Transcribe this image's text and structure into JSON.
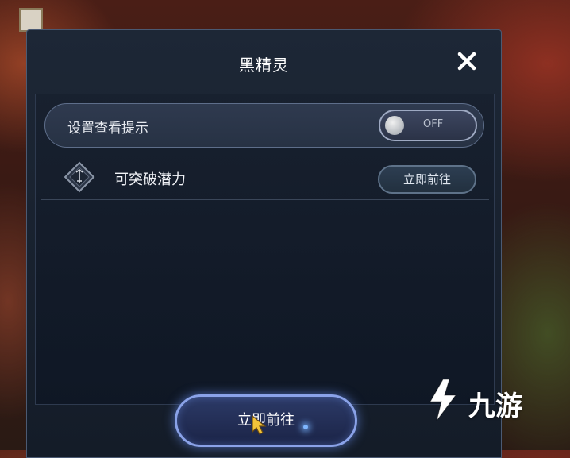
{
  "dialog": {
    "title": "黑精灵",
    "close_icon": "close-icon"
  },
  "settings": {
    "hint_label": "设置查看提示",
    "toggle_state": "OFF"
  },
  "items": [
    {
      "label": "可突破潜力",
      "button_label": "立即前往",
      "icon": "sword-diamond-icon"
    }
  ],
  "footer": {
    "primary_button_label": "立即前往"
  },
  "watermark": {
    "text": "九游"
  },
  "colors": {
    "accent_glow": "#8aa2e8",
    "panel_bg": "#141c28"
  }
}
